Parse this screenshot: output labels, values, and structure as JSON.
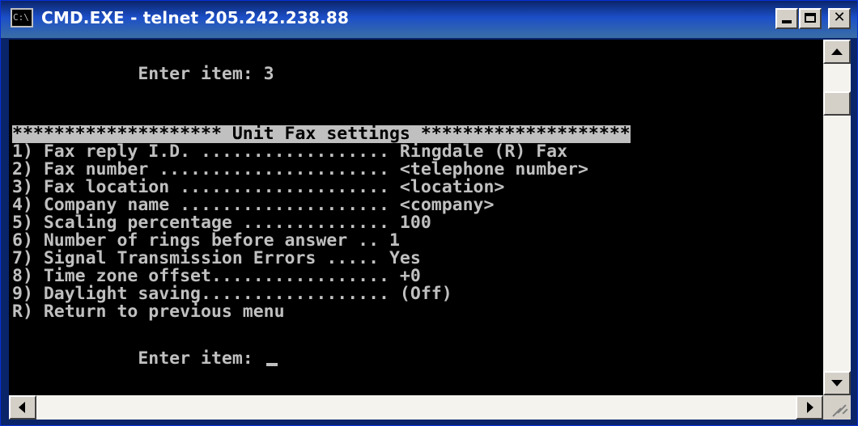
{
  "window": {
    "title": "CMD.EXE - telnet 205.242.238.88",
    "icon_label": "C:\\"
  },
  "console": {
    "lines": [
      "            Enter item: 3",
      "",
      "",
      "******************** Unit Fax settings ********************",
      "1) Fax reply I.D. .................. Ringdale (R) Fax",
      "2) Fax number ...................... <telephone number>",
      "3) Fax location .................... <location>",
      "4) Company name .................... <company>",
      "5) Scaling percentage .............. 100",
      "6) Number of rings before answer .. 1",
      "7) Signal Transmission Errors ..... Yes",
      "8) Time zone offset................. +0",
      "9) Daylight saving.................. (Off)",
      "R) Return to previous menu",
      "",
      "            Enter item: "
    ]
  },
  "colors": {
    "console_bg": "#000000",
    "console_fg": "#C0C0C0",
    "title_bar": "#0A246A"
  },
  "icons": {
    "minimize": "minimize-icon",
    "maximize": "maximize-icon",
    "close": "close-icon"
  }
}
